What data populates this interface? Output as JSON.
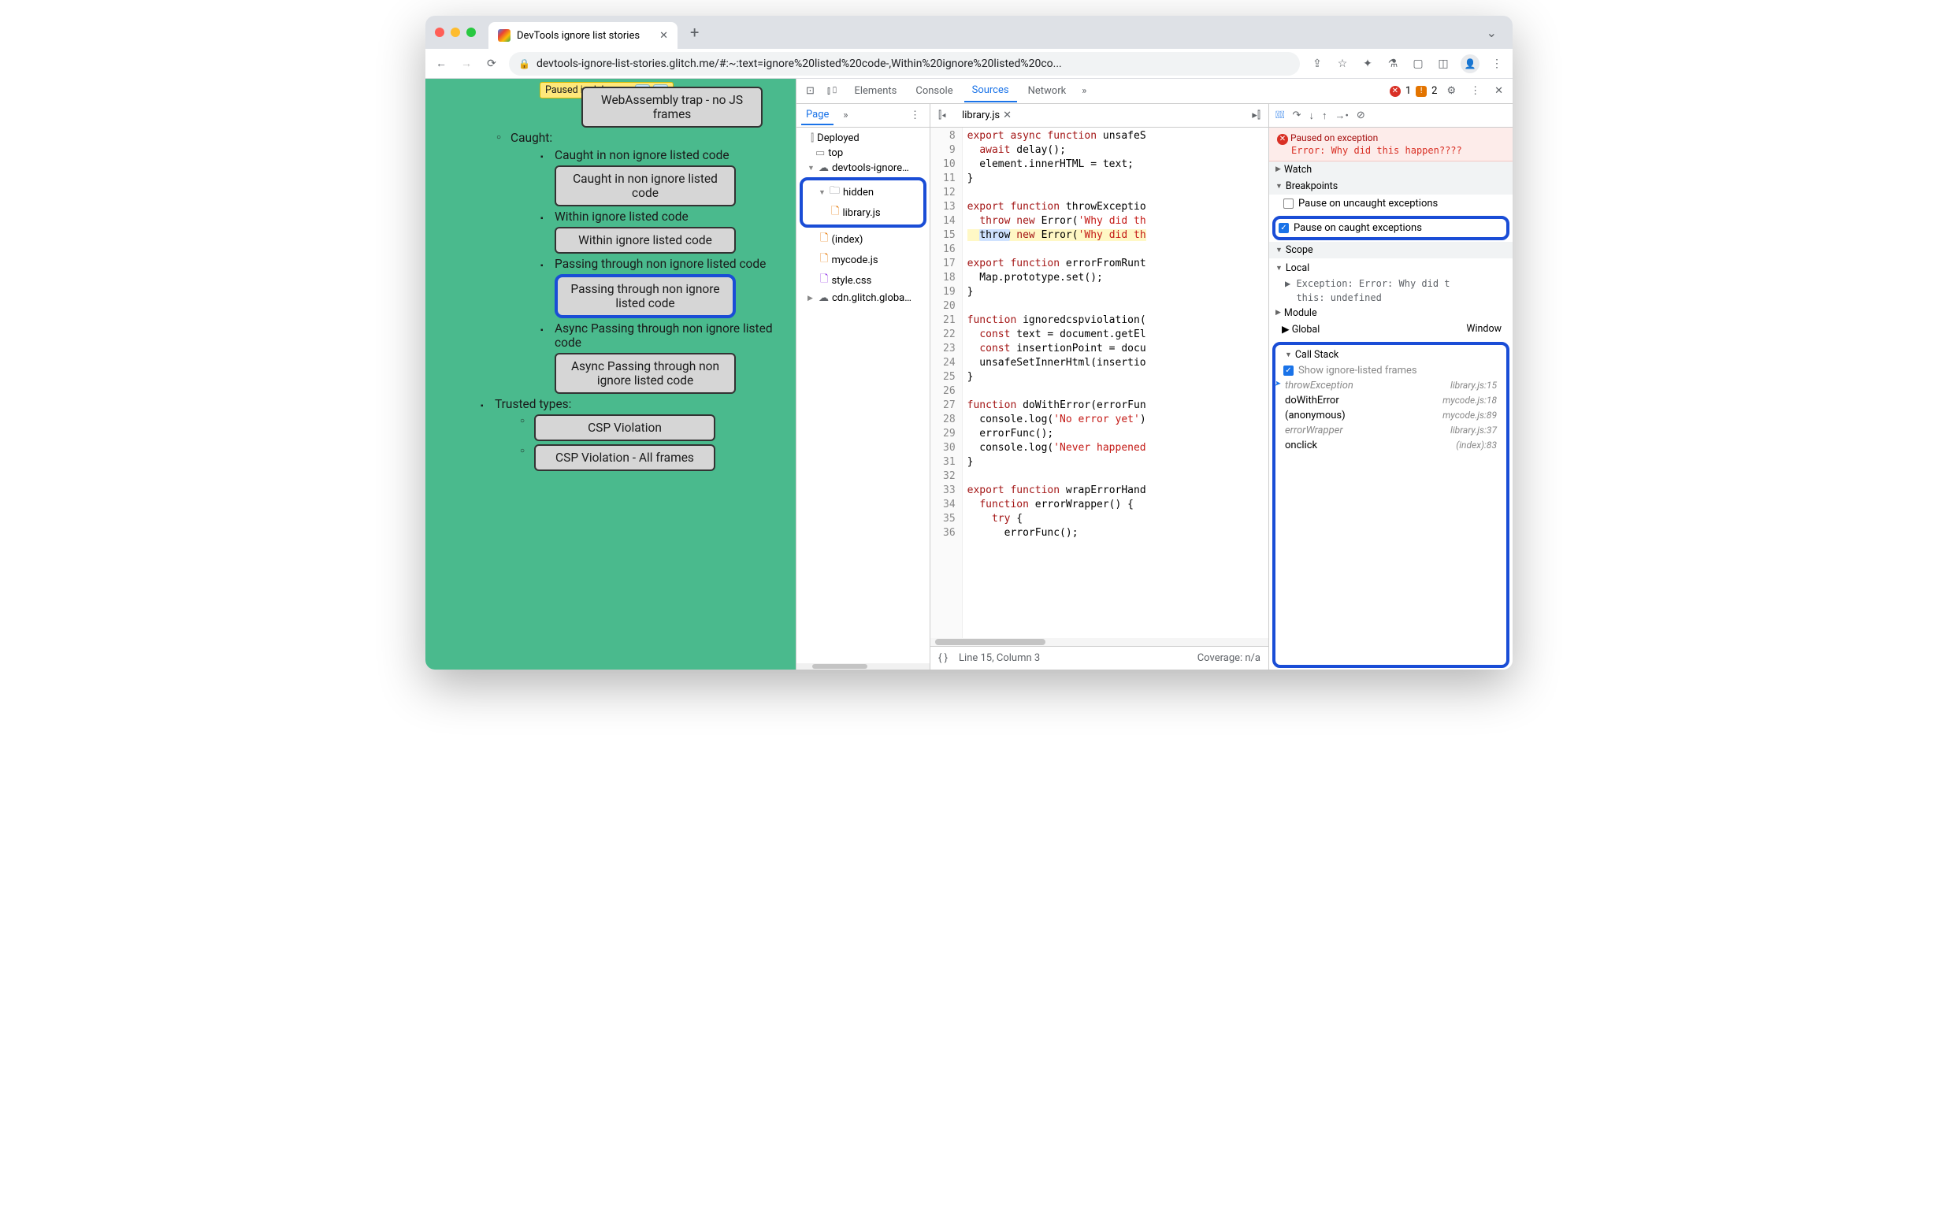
{
  "tab": {
    "title": "DevTools ignore list stories"
  },
  "url": "devtools-ignore-list-stories.glitch.me/#:~:text=ignore%20listed%20code-,Within%20ignore%20listed%20co...",
  "paused_badge": "Paused in debugger",
  "page_content": {
    "wasm_button": "WebAssembly trap - no JS frames",
    "caught_header": "Caught:",
    "items": [
      {
        "label": "Caught in non ignore listed code",
        "button": "Caught in non ignore listed code"
      },
      {
        "label": "Within ignore listed code",
        "button": "Within ignore listed code"
      },
      {
        "label": "Passing through non ignore listed code",
        "button": "Passing through non ignore listed code",
        "highlight": true
      },
      {
        "label": "Async Passing through non ignore listed code",
        "button": "Async Passing through non ignore listed code"
      }
    ],
    "trusted_header": "Trusted types:",
    "trusted_items": [
      "CSP Violation",
      "CSP Violation - All frames"
    ]
  },
  "devtools": {
    "tabs": [
      "Elements",
      "Console",
      "Sources",
      "Network"
    ],
    "active": "Sources",
    "errors": "1",
    "warnings": "2",
    "navigator": {
      "tab": "Page",
      "nodes": {
        "deployed": "Deployed",
        "top": "top",
        "origin": "devtools-ignore…",
        "hidden": "hidden",
        "library": "library.js",
        "index": "(index)",
        "mycode": "mycode.js",
        "style": "style.css",
        "cdn": "cdn.glitch.globa…"
      }
    },
    "editor": {
      "filename": "library.js",
      "first_line": 8,
      "lines": [
        "export async function unsafeS",
        "  await delay();",
        "  element.innerHTML = text;",
        "}",
        "",
        "export function throwExceptio",
        "  throw new Error('Why did th",
        "}",
        "",
        "export function errorFromRunt",
        "  Map.prototype.set();",
        "}",
        "",
        "function ignoredcspviolation(",
        "  const text = document.getEl",
        "  const insertionPoint = docu",
        "  unsafeSetInnerHtml(insertio",
        "}",
        "",
        "function doWithError(errorFun",
        "  console.log('No error yet')",
        "  errorFunc();",
        "  console.log('Never happened",
        "}",
        "",
        "export function wrapErrorHand",
        "  function errorWrapper() {",
        "    try {",
        "      errorFunc();"
      ],
      "paused_line_index": 7,
      "status_line": "Line 15, Column 3",
      "coverage": "Coverage: n/a"
    },
    "debugger": {
      "banner_title": "Paused on exception",
      "banner_msg": "Error: Why did this happen????",
      "watch": "Watch",
      "breakpoints": "Breakpoints",
      "bp_uncaught": "Pause on uncaught exceptions",
      "bp_caught": "Pause on caught exceptions",
      "scope": "Scope",
      "scope_local": "Local",
      "scope_exc": "Exception: Error: Why did t",
      "scope_this": "this: undefined",
      "scope_module": "Module",
      "scope_global": "Global",
      "scope_global_val": "Window",
      "callstack": "Call Stack",
      "cs_show": "Show ignore-listed frames",
      "frames": [
        {
          "fn": "throwException",
          "loc": "library.js:15",
          "ignored": true,
          "current": true
        },
        {
          "fn": "doWithError",
          "loc": "mycode.js:18"
        },
        {
          "fn": "(anonymous)",
          "loc": "mycode.js:89"
        },
        {
          "fn": "errorWrapper",
          "loc": "library.js:37",
          "ignored": true
        },
        {
          "fn": "onclick",
          "loc": "(index):83"
        }
      ]
    }
  }
}
